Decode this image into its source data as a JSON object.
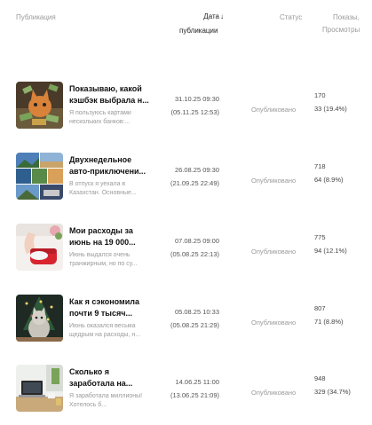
{
  "header": {
    "publication": "Публикация",
    "date": "Дата",
    "date_sub": "публикации",
    "status": "Статус",
    "views": "Показы,",
    "clicks": "Просмотры"
  },
  "rows": [
    {
      "title": "Показываю, какой кэшбэк выбрала н...",
      "excerpt": "Я пользуюсь картами нескольких банков:...",
      "date_published": "31.10.25 09:30",
      "date_updated": "(05.11.25 12:53)",
      "status": "Опубликовано",
      "impressions": "170",
      "views": "33 (19.4%)",
      "thumb_icon": "cat-with-money-icon"
    },
    {
      "title": "Двухнедельное авто-приключени...",
      "excerpt": "В отпуск я уехала в Казахстан. Основные...",
      "date_published": "26.08.25 09:30",
      "date_updated": "(21.09.25 22:49)",
      "status": "Опубликовано",
      "impressions": "718",
      "views": "64 (8.9%)",
      "thumb_icon": "travel-collage-icon"
    },
    {
      "title": "Мои расходы за июнь на 19 000...",
      "excerpt": "Июнь выдался очень транжирным, но по су...",
      "date_published": "07.08.25 09:00",
      "date_updated": "(05.08.25 22:13)",
      "status": "Опубликовано",
      "impressions": "775",
      "views": "94 (12.1%)",
      "thumb_icon": "red-purse-icon"
    },
    {
      "title": "Как я сэкономила почти 9 тысяч...",
      "excerpt": "Июнь оказался весьма щедрым на расходы, н...",
      "date_published": "05.08.25 10:33",
      "date_updated": "(05.08.25 21:29)",
      "status": "Опубликовано",
      "impressions": "807",
      "views": "71 (8.8%)",
      "thumb_icon": "cat-christmas-tree-icon"
    },
    {
      "title": "Сколько я заработала на...",
      "excerpt": "Я заработала миллионы! Хотелось б...",
      "date_published": "14.06.25 11:00",
      "date_updated": "(13.06.25 21:09)",
      "status": "Опубликовано",
      "impressions": "948",
      "views": "329 (34.7%)",
      "thumb_icon": "laptop-desk-icon"
    }
  ]
}
